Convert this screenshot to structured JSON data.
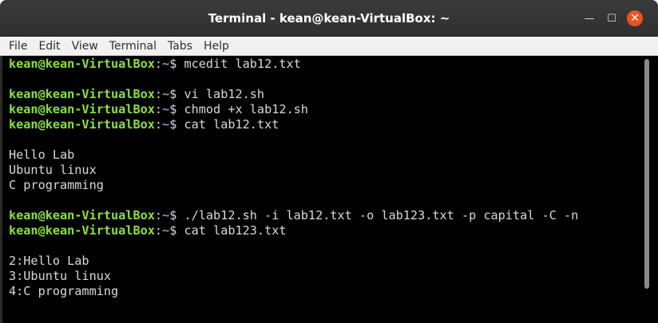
{
  "window": {
    "title": "Terminal - kean@kean-VirtualBox: ~",
    "minimize_glyph": "—",
    "maximize_glyph": "☐",
    "close_glyph": "✕"
  },
  "menubar": {
    "items": [
      "File",
      "Edit",
      "View",
      "Terminal",
      "Tabs",
      "Help"
    ]
  },
  "terminal": {
    "prompt_user": "kean@kean-VirtualBox",
    "prompt_sep": ":",
    "prompt_path": "~",
    "lines": [
      {
        "type": "prompt",
        "command": "mcedit lab12.txt"
      },
      {
        "type": "output",
        "text": ""
      },
      {
        "type": "prompt",
        "command": "vi lab12.sh"
      },
      {
        "type": "prompt",
        "command": "chmod +x lab12.sh"
      },
      {
        "type": "prompt",
        "command": "cat lab12.txt"
      },
      {
        "type": "output",
        "text": ""
      },
      {
        "type": "output",
        "text": "Hello Lab"
      },
      {
        "type": "output",
        "text": "Ubuntu linux"
      },
      {
        "type": "output",
        "text": "C programming"
      },
      {
        "type": "output",
        "text": ""
      },
      {
        "type": "prompt",
        "command": "./lab12.sh -i lab12.txt -o lab123.txt -p capital -C -n"
      },
      {
        "type": "prompt",
        "command": "cat lab123.txt"
      },
      {
        "type": "output",
        "text": ""
      },
      {
        "type": "output",
        "text": "2:Hello Lab"
      },
      {
        "type": "output",
        "text": "3:Ubuntu linux"
      },
      {
        "type": "output",
        "text": "4:C programming"
      }
    ]
  },
  "colors": {
    "prompt_user": "#8ae234",
    "prompt_path": "#729fcf",
    "terminal_bg": "#000000",
    "terminal_fg": "#d9d9d9",
    "close_button": "#e95420"
  }
}
